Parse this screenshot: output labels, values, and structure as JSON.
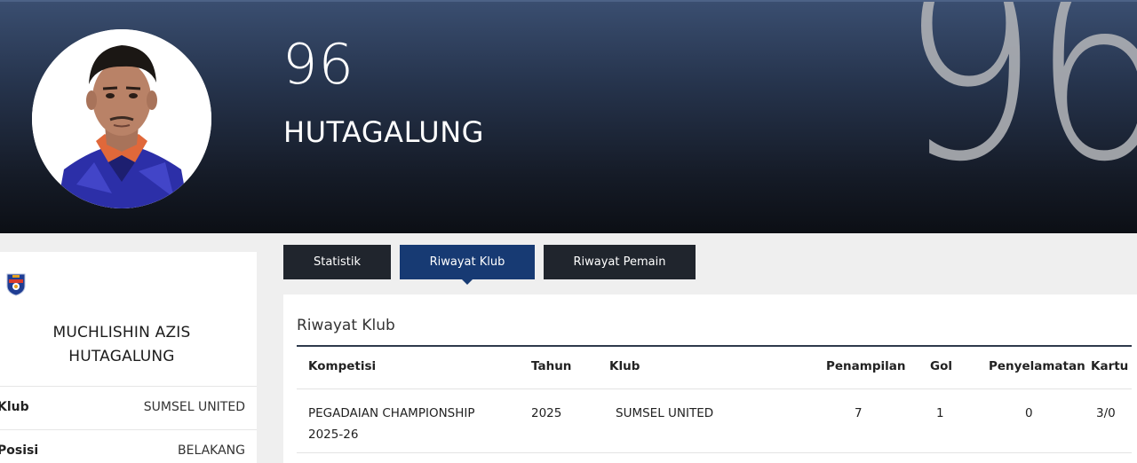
{
  "hero": {
    "number": "96",
    "name": "HUTAGALUNG",
    "bg_number": "96"
  },
  "profile": {
    "full_name_line1": "MUCHLISHIN AZIS",
    "full_name_line2": "HUTAGALUNG",
    "rows": [
      {
        "label": "Klub",
        "value": "SUMSEL UNITED"
      },
      {
        "label": "Posisi",
        "value": "BELAKANG"
      }
    ]
  },
  "tabs": [
    {
      "label": "Statistik",
      "active": false
    },
    {
      "label": "Riwayat Klub",
      "active": true
    },
    {
      "label": "Riwayat Pemain",
      "active": false
    }
  ],
  "club_history": {
    "title": "Riwayat Klub",
    "headers": [
      "Kompetisi",
      "Tahun",
      "Klub",
      "Penampilan",
      "Gol",
      "Penyelamatan",
      "Kartu"
    ],
    "rows": [
      {
        "competition_line1": "PEGADAIAN CHAMPIONSHIP",
        "competition_line2": "2025-26",
        "year": "2025",
        "club": "SUMSEL UNITED",
        "appearances": "7",
        "goals": "1",
        "saves": "0",
        "cards": "3/0"
      }
    ]
  },
  "colors": {
    "active_tab": "#173a73",
    "tab": "#20252d",
    "hero_top": "#3a4e70",
    "hero_bottom": "#0c0f15"
  }
}
